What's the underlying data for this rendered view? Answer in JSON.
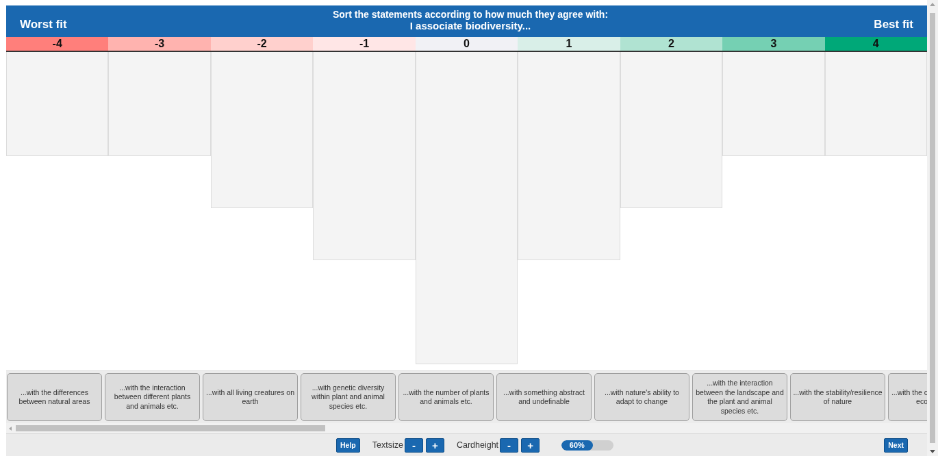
{
  "header": {
    "left_label": "Worst fit",
    "instruction": "Sort the statements according to how much they agree with:",
    "statement": "I associate biodiversity...",
    "right_label": "Best fit"
  },
  "columns": [
    {
      "label": "-4",
      "color": "#ff7f7b",
      "slots": [
        {
          "kind": "empty"
        },
        {
          "kind": "empty"
        }
      ]
    },
    {
      "label": "-3",
      "color": "#ffb3af",
      "slots": [
        {
          "kind": "empty"
        },
        {
          "kind": "empty"
        }
      ]
    },
    {
      "label": "-2",
      "color": "#ffd0cd",
      "slots": [
        {
          "kind": "empty"
        },
        {
          "kind": "empty"
        },
        {
          "kind": "empty"
        }
      ]
    },
    {
      "label": "-1",
      "color": "#ffe6e6",
      "slots": [
        {
          "kind": "empty"
        },
        {
          "kind": "empty"
        },
        {
          "kind": "empty"
        },
        {
          "kind": "empty"
        }
      ]
    },
    {
      "label": "0",
      "color": "#f1f1f5",
      "slots": [
        {
          "kind": "empty"
        },
        {
          "kind": "empty"
        },
        {
          "kind": "empty"
        },
        {
          "kind": "empty"
        },
        {
          "kind": "empty"
        },
        {
          "kind": "empty"
        }
      ]
    },
    {
      "label": "1",
      "color": "#d9efe8",
      "slots": [
        {
          "kind": "empty"
        },
        {
          "kind": "empty"
        },
        {
          "kind": "empty"
        },
        {
          "kind": "empty"
        }
      ]
    },
    {
      "label": "2",
      "color": "#b0e3d2",
      "slots": [
        {
          "kind": "empty"
        },
        {
          "kind": "empty"
        },
        {
          "kind": "empty"
        }
      ]
    },
    {
      "label": "3",
      "color": "#75d0b3",
      "slots": [
        {
          "kind": "empty"
        },
        {
          "kind": "empty"
        }
      ]
    },
    {
      "label": "4",
      "color": "#00a878",
      "slots": [
        {
          "kind": "empty"
        },
        {
          "kind": "empty"
        }
      ]
    }
  ],
  "cards": [
    {
      "text": "...with the differences between natural areas",
      "kind": "full"
    },
    {
      "text": "...with the interaction between different plants and animals etc.",
      "kind": "full"
    },
    {
      "text": "...with all living creatures on earth",
      "kind": "full"
    },
    {
      "text": "...with genetic diversity within plant and animal species etc.",
      "kind": "full"
    },
    {
      "text": "...with the number of plants and animals etc.",
      "kind": "full"
    },
    {
      "text": "...with something abstract and undefinable",
      "kind": "full"
    },
    {
      "text": "...with nature's ability to adapt to change",
      "kind": "full"
    },
    {
      "text": "...with the interaction between the landscape and the plant and animal species etc.",
      "kind": "full"
    },
    {
      "text": "...with the stability/resilience of nature",
      "kind": "full"
    },
    {
      "text": "...with the c\neco",
      "kind": "cut"
    }
  ],
  "footer": {
    "help": "Help",
    "textsize_label": "Textsize",
    "textsize_minus": "-",
    "textsize_plus": "+",
    "cardheight_label": "Cardheight",
    "cardheight_minus": "-",
    "cardheight_plus": "+",
    "progress": {
      "level": 0.6,
      "text": "60%"
    },
    "next": "Next"
  }
}
